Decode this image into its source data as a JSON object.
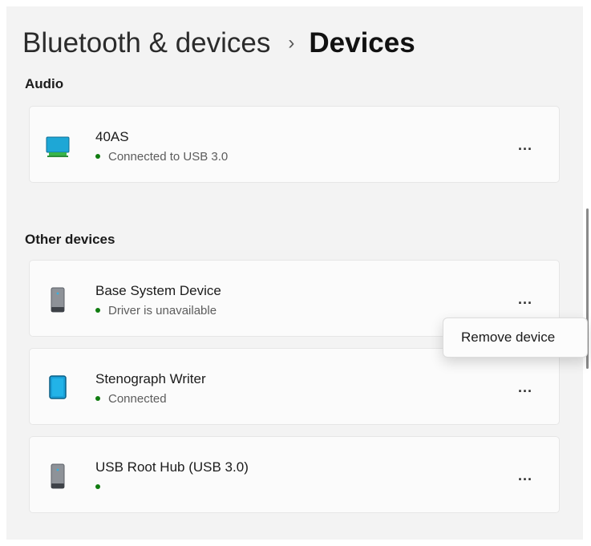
{
  "header": {
    "breadcrumb_parent": "Bluetooth & devices",
    "separator": "›",
    "breadcrumb_current": "Devices"
  },
  "sections": [
    {
      "label": "Audio",
      "devices": [
        {
          "name": "40AS",
          "status": "Connected to USB 3.0",
          "icon": "monitor-icon",
          "status_color": "#107c10",
          "more": "..."
        }
      ]
    },
    {
      "label": "Other devices",
      "devices": [
        {
          "name": "Base System Device",
          "status": "Driver is unavailable",
          "icon": "generic-device-icon",
          "status_color": "#107c10",
          "more": "..."
        },
        {
          "name": "Stenograph Writer",
          "status": "Connected",
          "icon": "tablet-icon",
          "status_color": "#107c10",
          "more": "..."
        },
        {
          "name": "USB Root Hub (USB 3.0)",
          "status": "",
          "icon": "generic-device-icon",
          "status_color": "#107c10",
          "more": "..."
        }
      ]
    }
  ],
  "context_menu": {
    "items": [
      {
        "label": "Remove device"
      }
    ]
  },
  "colors": {
    "status_dot": "#107c10",
    "monitor_screen": "#1ea7d6",
    "tablet_screen": "#1aa0d8"
  }
}
